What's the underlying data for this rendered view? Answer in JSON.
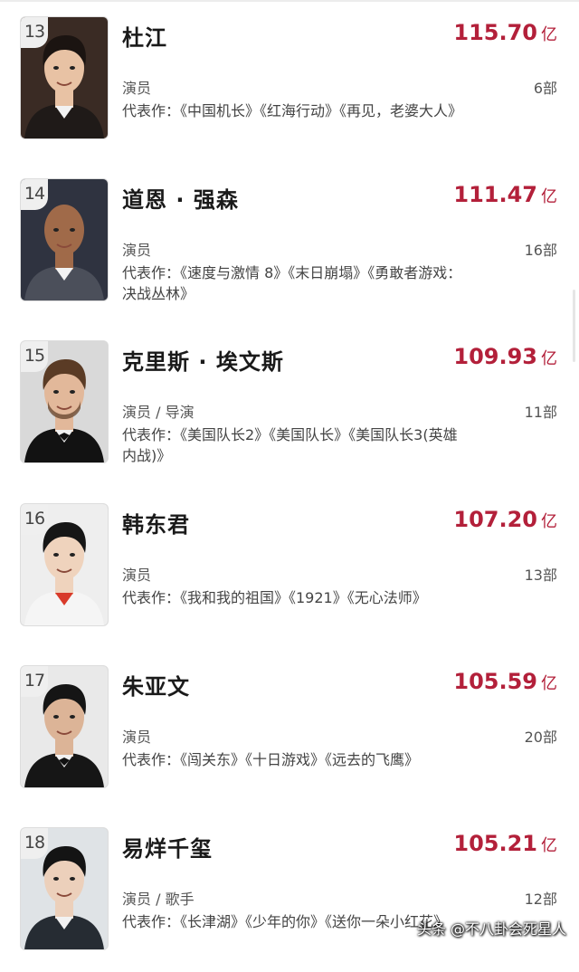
{
  "actors": [
    {
      "rank": "13",
      "name": "杜江",
      "amount": "115.70",
      "unit": "亿",
      "role": "演员",
      "count": "6部",
      "works": "代表作：《中国机长》《红海行动》《再见，老婆大人》",
      "bg": "#3a2b24",
      "suit": "#1f1a18",
      "skin": "#e8c2a4",
      "hair": "#1b1411"
    },
    {
      "rank": "14",
      "name": "道恩 · 强森",
      "amount": "111.47",
      "unit": "亿",
      "role": "演员",
      "count": "16部",
      "works": "代表作：《速度与激情 8》《末日崩塌》《勇敢者游戏：决战丛林》",
      "bg": "#2f3340",
      "suit": "#4b4f5a",
      "skin": "#a06a49",
      "hair": "#a06a49"
    },
    {
      "rank": "15",
      "name": "克里斯 · 埃文斯",
      "amount": "109.93",
      "unit": "亿",
      "role": "演员 / 导演",
      "count": "11部",
      "works": "代表作：《美国队长2》《美国队长》《美国队长3(英雄内战)》",
      "bg": "#d9d9d9",
      "suit": "#121212",
      "skin": "#e2b89a",
      "hair": "#5a3b25"
    },
    {
      "rank": "16",
      "name": "韩东君",
      "amount": "107.20",
      "unit": "亿",
      "role": "演员",
      "count": "13部",
      "works": "代表作：《我和我的祖国》《1921》《无心法师》",
      "bg": "#eeeeee",
      "suit": "#f5f5f5",
      "skin": "#efd3bd",
      "hair": "#161616"
    },
    {
      "rank": "17",
      "name": "朱亚文",
      "amount": "105.59",
      "unit": "亿",
      "role": "演员",
      "count": "20部",
      "works": "代表作：《闯关东》《十日游戏》《远去的飞鹰》",
      "bg": "#e9e9e9",
      "suit": "#161616",
      "skin": "#dcb497",
      "hair": "#151515"
    },
    {
      "rank": "18",
      "name": "易烊千玺",
      "amount": "105.21",
      "unit": "亿",
      "role": "演员 / 歌手",
      "count": "12部",
      "works": "代表作：《长津湖》《少年的你》《送你一朵小红花》",
      "bg": "#dfe3e6",
      "suit": "#262c33",
      "skin": "#ecd0bb",
      "hair": "#141414"
    }
  ],
  "watermark": "头条 @不八卦会死星人"
}
